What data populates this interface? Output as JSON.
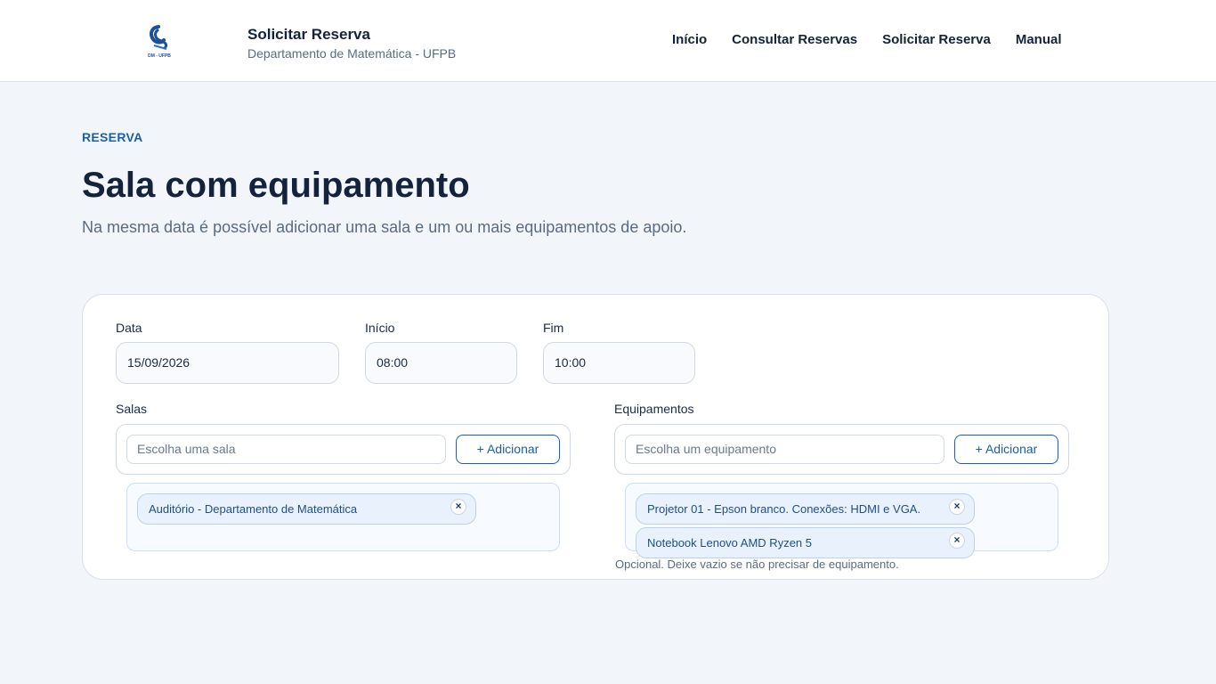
{
  "header": {
    "logo_text": "DM - UFPB",
    "title": "Solicitar Reserva",
    "subtitle": "Departamento de Matemática - UFPB",
    "nav": [
      "Início",
      "Consultar Reservas",
      "Solicitar Reserva",
      "Manual"
    ]
  },
  "hero": {
    "eyebrow": "RESERVA",
    "title": "Sala com equipamento",
    "subtitle": "Na mesma data é possível adicionar uma sala e um ou mais equipamentos de apoio."
  },
  "form": {
    "date": {
      "label": "Data",
      "value": "15/09/2026"
    },
    "start": {
      "label": "Início",
      "value": "08:00"
    },
    "end": {
      "label": "Fim",
      "value": "10:00"
    },
    "rooms": {
      "label": "Salas",
      "placeholder": "Escolha uma sala",
      "add_label": "+ Adicionar",
      "selected": [
        "Auditório - Departamento de Matemática"
      ]
    },
    "equipment": {
      "label": "Equipamentos",
      "placeholder": "Escolha um equipamento",
      "add_label": "+ Adicionar",
      "selected": [
        "Projetor 01 - Epson branco. Conexões: HDMI e VGA.",
        "Notebook Lenovo AMD Ryzen 5"
      ],
      "hint": "Opcional. Deixe vazio se não precisar de equipamento."
    },
    "remove_glyph": "×"
  },
  "colors": {
    "accent": "#1c5fa8",
    "background": "#f2f6fb",
    "chip_bg": "#e9f2fc"
  }
}
